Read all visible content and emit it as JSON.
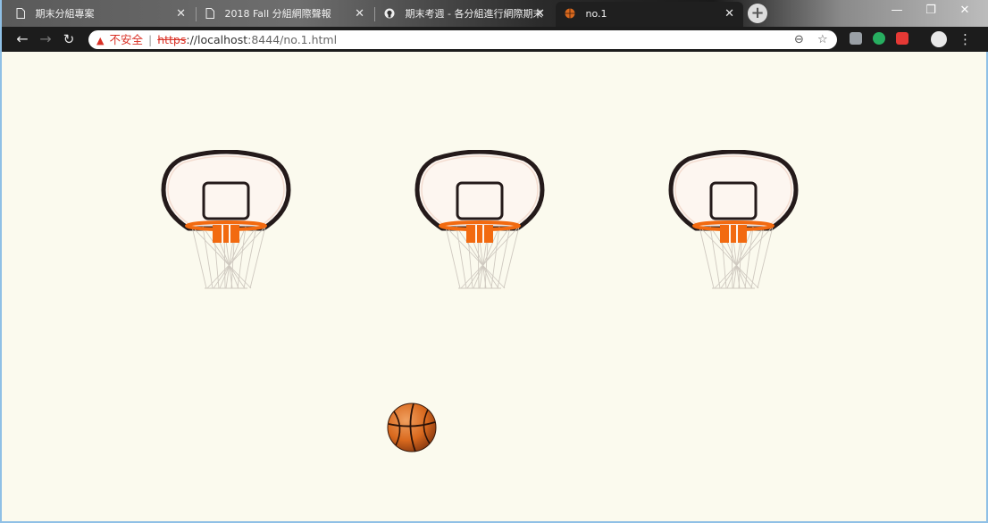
{
  "browser": {
    "tabs": [
      {
        "title": "期末分組專案",
        "active": false
      },
      {
        "title": "2018 Fall 分組網際聲報",
        "active": false
      },
      {
        "title": "期末考週 - 各分組進行網際期末",
        "active": false
      },
      {
        "title": "no.1",
        "active": true
      }
    ],
    "security_label": "不安全",
    "url_protocol": "https",
    "url_host": "://localhost",
    "url_path": ":8444/no.1.html",
    "window_controls": {
      "minimize": "—",
      "maximize": "❐",
      "close": "✕"
    }
  },
  "game": {
    "hoops": [
      {
        "name": "hoop-left"
      },
      {
        "name": "hoop-center"
      },
      {
        "name": "hoop-right"
      }
    ],
    "colors": {
      "background": "#fbfaee",
      "rim": "#f26a10",
      "board_outline": "#241a1a",
      "ball": "#d9691e"
    }
  }
}
